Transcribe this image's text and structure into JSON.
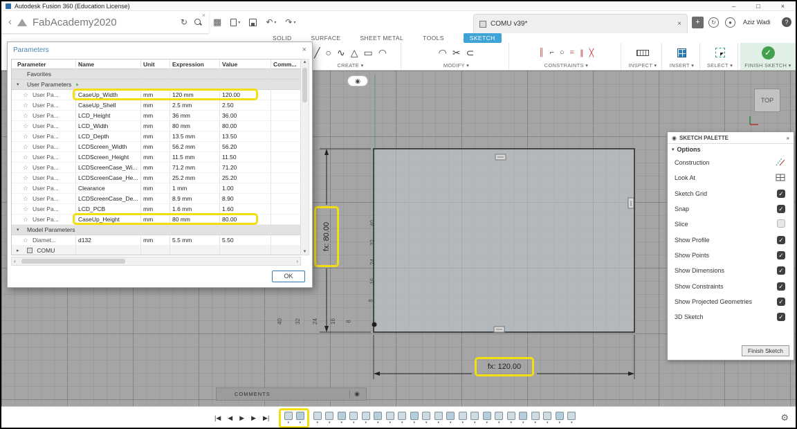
{
  "window": {
    "title": "Autodesk Fusion 360 (Education License)"
  },
  "browser": {
    "title": "FabAcademy2020"
  },
  "document_tab": {
    "label": "COMU v39*"
  },
  "account": {
    "user_name": "Aziz Wadi"
  },
  "ribbon": {
    "tabs": [
      "SOLID",
      "SURFACE",
      "SHEET METAL",
      "TOOLS"
    ],
    "active_tab": "SKETCH",
    "groups": [
      "CREATE",
      "MODIFY",
      "CONSTRAINTS",
      "INSPECT",
      "INSERT",
      "SELECT",
      "FINISH SKETCH"
    ]
  },
  "parameters_dialog": {
    "title": "Parameters",
    "columns": [
      "Parameter",
      "Name",
      "Unit",
      "Expression",
      "Value",
      "Comm..."
    ],
    "favorites_label": "Favorites",
    "user_section_label": "User Parameters",
    "model_section_label": "Model Parameters",
    "comu_label": "COMU",
    "ok_label": "OK",
    "rows": [
      {
        "label": "User Pa...",
        "name": "CaseUp_Width",
        "unit": "mm",
        "expression": "120 mm",
        "value": "120.00",
        "highlight": true
      },
      {
        "label": "User Pa...",
        "name": "CaseUp_Shell",
        "unit": "mm",
        "expression": "2.5 mm",
        "value": "2.50"
      },
      {
        "label": "User Pa...",
        "name": "LCD_Height",
        "unit": "mm",
        "expression": "36 mm",
        "value": "36.00"
      },
      {
        "label": "User Pa...",
        "name": "LCD_Width",
        "unit": "mm",
        "expression": "80 mm",
        "value": "80.00"
      },
      {
        "label": "User Pa...",
        "name": "LCD_Depth",
        "unit": "mm",
        "expression": "13.5 mm",
        "value": "13.50"
      },
      {
        "label": "User Pa...",
        "name": "LCDScreen_Width",
        "unit": "mm",
        "expression": "56.2 mm",
        "value": "56.20"
      },
      {
        "label": "User Pa...",
        "name": "LCDScreen_Height",
        "unit": "mm",
        "expression": "11.5 mm",
        "value": "11.50"
      },
      {
        "label": "User Pa...",
        "name": "LCDScreenCase_Wi...",
        "unit": "mm",
        "expression": "71.2 mm",
        "value": "71.20"
      },
      {
        "label": "User Pa...",
        "name": "LCDScreenCase_He...",
        "unit": "mm",
        "expression": "25.2 mm",
        "value": "25.20"
      },
      {
        "label": "User Pa...",
        "name": "Clearance",
        "unit": "mm",
        "expression": "1 mm",
        "value": "1.00"
      },
      {
        "label": "User Pa...",
        "name": "LCDScreenCase_De...",
        "unit": "mm",
        "expression": "8.9 mm",
        "value": "8.90"
      },
      {
        "label": "User Pa...",
        "name": "LCD_PCB",
        "unit": "mm",
        "expression": "1.6 mm",
        "value": "1.60"
      },
      {
        "label": "User Pa...",
        "name": "CaseUp_Height",
        "unit": "mm",
        "expression": "80 mm",
        "value": "80.00",
        "highlight": true
      }
    ],
    "model_rows": [
      {
        "label": "Diamet...",
        "name": "d132",
        "unit": "mm",
        "expression": "5.5 mm",
        "value": "5.50"
      }
    ]
  },
  "canvas": {
    "view_cube_label": "TOP",
    "width_dimension": "fx: 120.00",
    "height_dimension": "fx: 80.00",
    "h_ruler": [
      "40",
      "32",
      "24",
      "16",
      "8"
    ],
    "v_ruler": [
      "40",
      "32",
      "24",
      "16",
      "8"
    ]
  },
  "sketch_palette": {
    "title": "SKETCH PALETTE",
    "section_label": "Options",
    "items": [
      {
        "label": "Construction",
        "type": "icon",
        "icon": "construction-icon"
      },
      {
        "label": "Look At",
        "type": "icon",
        "icon": "look-at-icon"
      },
      {
        "label": "Sketch Grid",
        "type": "check",
        "checked": true
      },
      {
        "label": "Snap",
        "type": "check",
        "checked": true
      },
      {
        "label": "Slice",
        "type": "check",
        "checked": false
      },
      {
        "label": "Show Profile",
        "type": "check",
        "checked": true
      },
      {
        "label": "Show Points",
        "type": "check",
        "checked": true
      },
      {
        "label": "Show Dimensions",
        "type": "check",
        "checked": true
      },
      {
        "label": "Show Constraints",
        "type": "check",
        "checked": true
      },
      {
        "label": "Show Projected Geometries",
        "type": "check",
        "checked": true
      },
      {
        "label": "3D Sketch",
        "type": "check",
        "checked": true
      }
    ],
    "finish_button_label": "Finish Sketch"
  },
  "comments": {
    "label": "COMMENTS"
  },
  "timeline": {
    "item_count": 24,
    "highlight_count": 2
  }
}
